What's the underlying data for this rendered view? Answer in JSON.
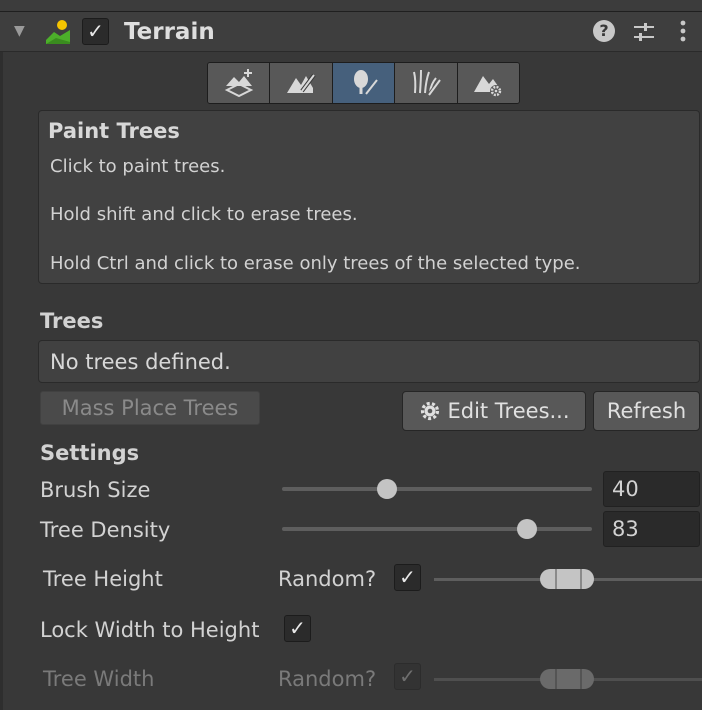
{
  "header": {
    "title": "Terrain",
    "foldout_glyph": "▼",
    "enabled_check": "✓",
    "help_glyph": "?",
    "menu_glyph": "⋮",
    "icons": [
      "terrain-icon",
      "help-icon",
      "presets-icon",
      "kebab-menu-icon"
    ]
  },
  "toolbar": {
    "tools": [
      {
        "name": "create-neighbor-terrains",
        "active": false
      },
      {
        "name": "paint-terrain",
        "active": false
      },
      {
        "name": "paint-trees",
        "active": true
      },
      {
        "name": "paint-details",
        "active": false
      },
      {
        "name": "terrain-settings",
        "active": false
      }
    ],
    "active_color": "#46607c"
  },
  "help": {
    "title": "Paint Trees",
    "lines": [
      "Click to paint trees.",
      "Hold shift and click to erase trees.",
      "Hold Ctrl and click to erase only trees of the selected type."
    ]
  },
  "trees": {
    "heading": "Trees",
    "empty_message": "No trees defined.",
    "mass_place_label": "Mass Place Trees",
    "edit_trees_label": "Edit Trees...",
    "refresh_label": "Refresh"
  },
  "settings": {
    "heading": "Settings",
    "brush_size": {
      "label": "Brush Size",
      "value": "40",
      "slider_fraction": 0.336
    },
    "tree_density": {
      "label": "Tree Density",
      "value": "83",
      "slider_fraction": 0.787
    },
    "tree_height": {
      "label": "Tree Height",
      "random_label": "Random?",
      "random": true,
      "check": "✓"
    },
    "lock_width": {
      "label": "Lock Width to Height",
      "checked": true,
      "check": "✓"
    },
    "tree_width": {
      "label": "Tree Width",
      "random_label": "Random?",
      "random": true,
      "check": "✓",
      "disabled": true
    }
  }
}
